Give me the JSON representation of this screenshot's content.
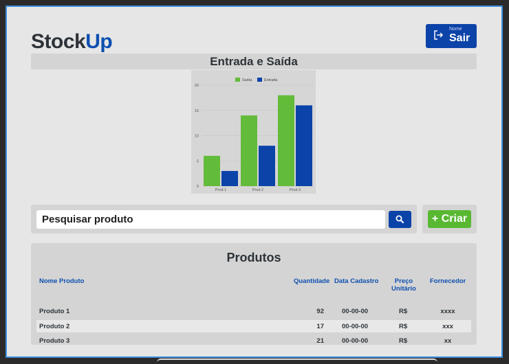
{
  "header": {
    "logo_main": "Stock",
    "logo_accent": "Up",
    "user_label": "Nome",
    "logout_label": "Sair"
  },
  "section_title": "Entrada e Saída",
  "chart_data": {
    "type": "bar",
    "categories": [
      "Prod 1",
      "Prod 2",
      "Prod 3"
    ],
    "series": [
      {
        "name": "Saída",
        "values": [
          6,
          14,
          18
        ],
        "color": "#63bb3a"
      },
      {
        "name": "Entrada",
        "values": [
          3,
          8,
          16
        ],
        "color": "#0b43a8"
      }
    ],
    "ylim": [
      0,
      20
    ],
    "yticks": [
      "0",
      "5",
      "10",
      "15",
      "20"
    ],
    "grid": true,
    "legend": "top-center"
  },
  "search": {
    "value": "Pesquisar produto",
    "button_icon": "search-icon"
  },
  "create_button": {
    "label": "Criar",
    "icon": "plus-icon"
  },
  "products": {
    "title": "Produtos",
    "columns": [
      "Nome Produto",
      "Quantidade",
      "Data Cadastro",
      "Preço",
      "Unitário",
      "Fornecedor"
    ],
    "rows": [
      {
        "name": "Produto 1",
        "qty": "92",
        "date": "00-00-00",
        "price": "R$",
        "supplier": "xxxx"
      },
      {
        "name": "Produto 2",
        "qty": "17",
        "date": "00-00-00",
        "price": "R$",
        "supplier": "xxx"
      },
      {
        "name": "Produto 3",
        "qty": "21",
        "date": "00-00-00",
        "price": "R$",
        "supplier": "xx"
      }
    ]
  }
}
